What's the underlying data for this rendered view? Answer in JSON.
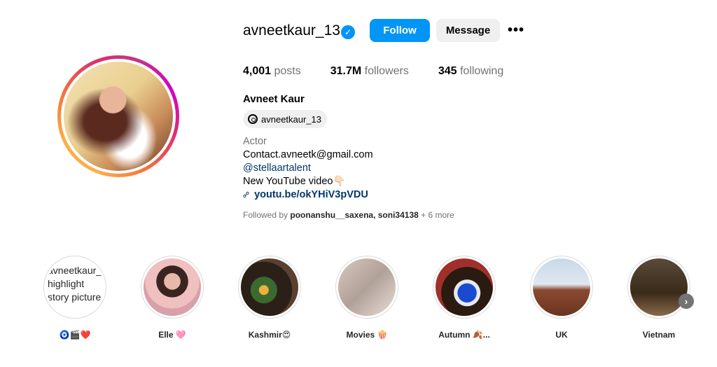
{
  "profile": {
    "username": "avneetkaur_13",
    "follow_label": "Follow",
    "message_label": "Message",
    "more_label": "•••",
    "stats": [
      {
        "value": "4,001",
        "label": "posts"
      },
      {
        "value": "31.7M",
        "label": "followers"
      },
      {
        "value": "345",
        "label": "following"
      }
    ],
    "full_name": "Avneet Kaur",
    "threads_handle": "avneetkaur_13",
    "bio": {
      "category": "Actor",
      "line1": "Contact.avneetk@gmail.com",
      "mention": "@stellaartalent",
      "line3": "New YouTube video👇🏻",
      "link": "youtu.be/okYHiV3pVDU"
    },
    "followed_by": {
      "prefix": "Followed by",
      "users": "poonanshu__saxena, soni34138",
      "suffix": "+ 6 more"
    }
  },
  "highlights": [
    {
      "label": "🧿🎬❤️",
      "broken_alt": "avneetkaur_'s highlight story picture"
    },
    {
      "label": "Elle 🩷"
    },
    {
      "label": "Kashmir😍"
    },
    {
      "label": "Movies 🍿"
    },
    {
      "label": "Autumn 🍂..."
    },
    {
      "label": "UK"
    },
    {
      "label": "Vietnam"
    }
  ],
  "colors": {
    "accent": "#0095f6",
    "link": "#00376b",
    "muted": "#737373"
  }
}
